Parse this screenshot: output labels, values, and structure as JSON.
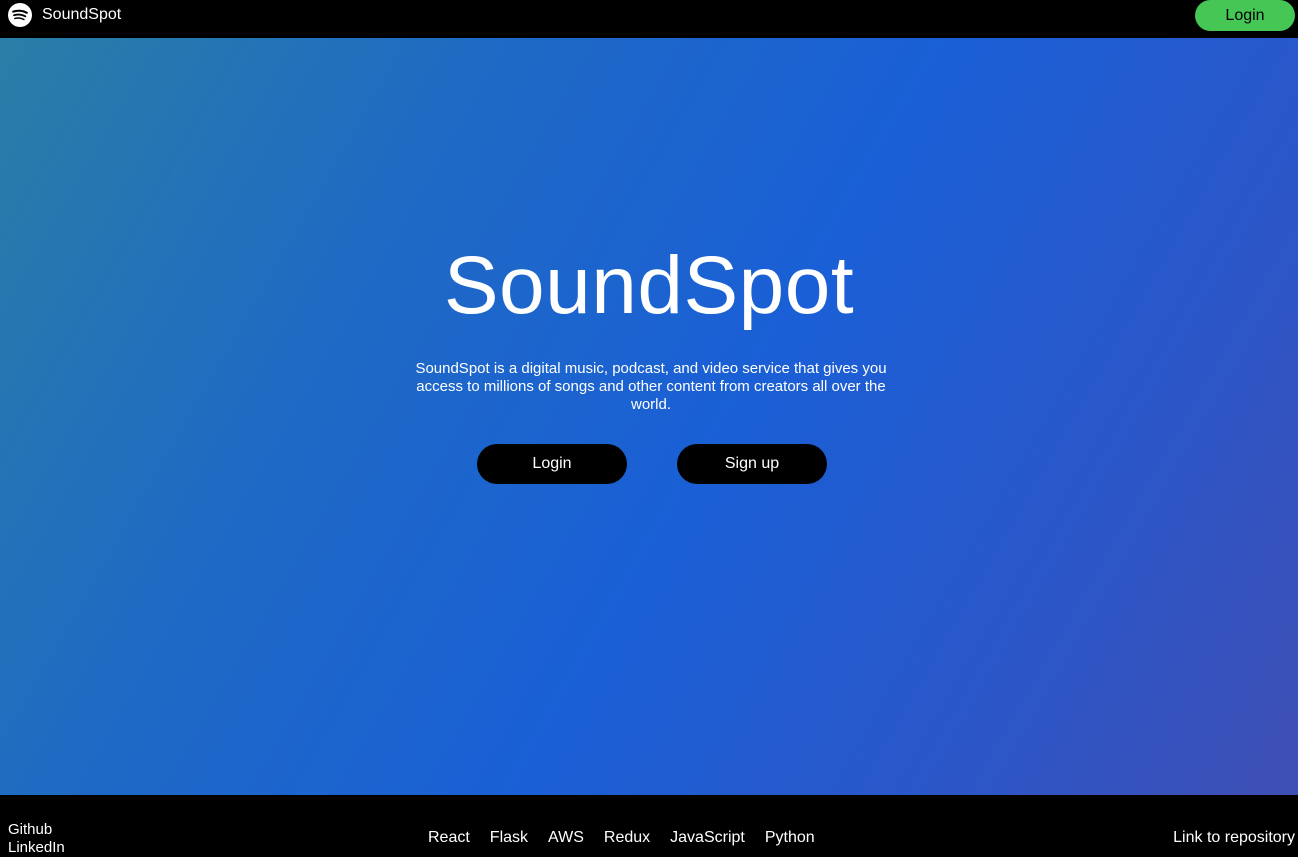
{
  "navbar": {
    "brand_icon": "spotify-logo-icon",
    "brand_name": "SoundSpot",
    "login_label": "Login",
    "login_color": "#45c655"
  },
  "hero": {
    "title": "SoundSpot",
    "description": "SoundSpot is a digital music, podcast, and video service that gives you access to millions of songs and other content from creators all over the world.",
    "login_label": "Login",
    "signup_label": "Sign up",
    "gradient_colors": [
      "#2a7ea6",
      "#1a5fd6",
      "#3f4fb5"
    ]
  },
  "footer": {
    "social": [
      "Github",
      "LinkedIn"
    ],
    "tech": [
      "React",
      "Flask",
      "AWS",
      "Redux",
      "JavaScript",
      "Python"
    ],
    "repo_link": "Link to repository"
  }
}
